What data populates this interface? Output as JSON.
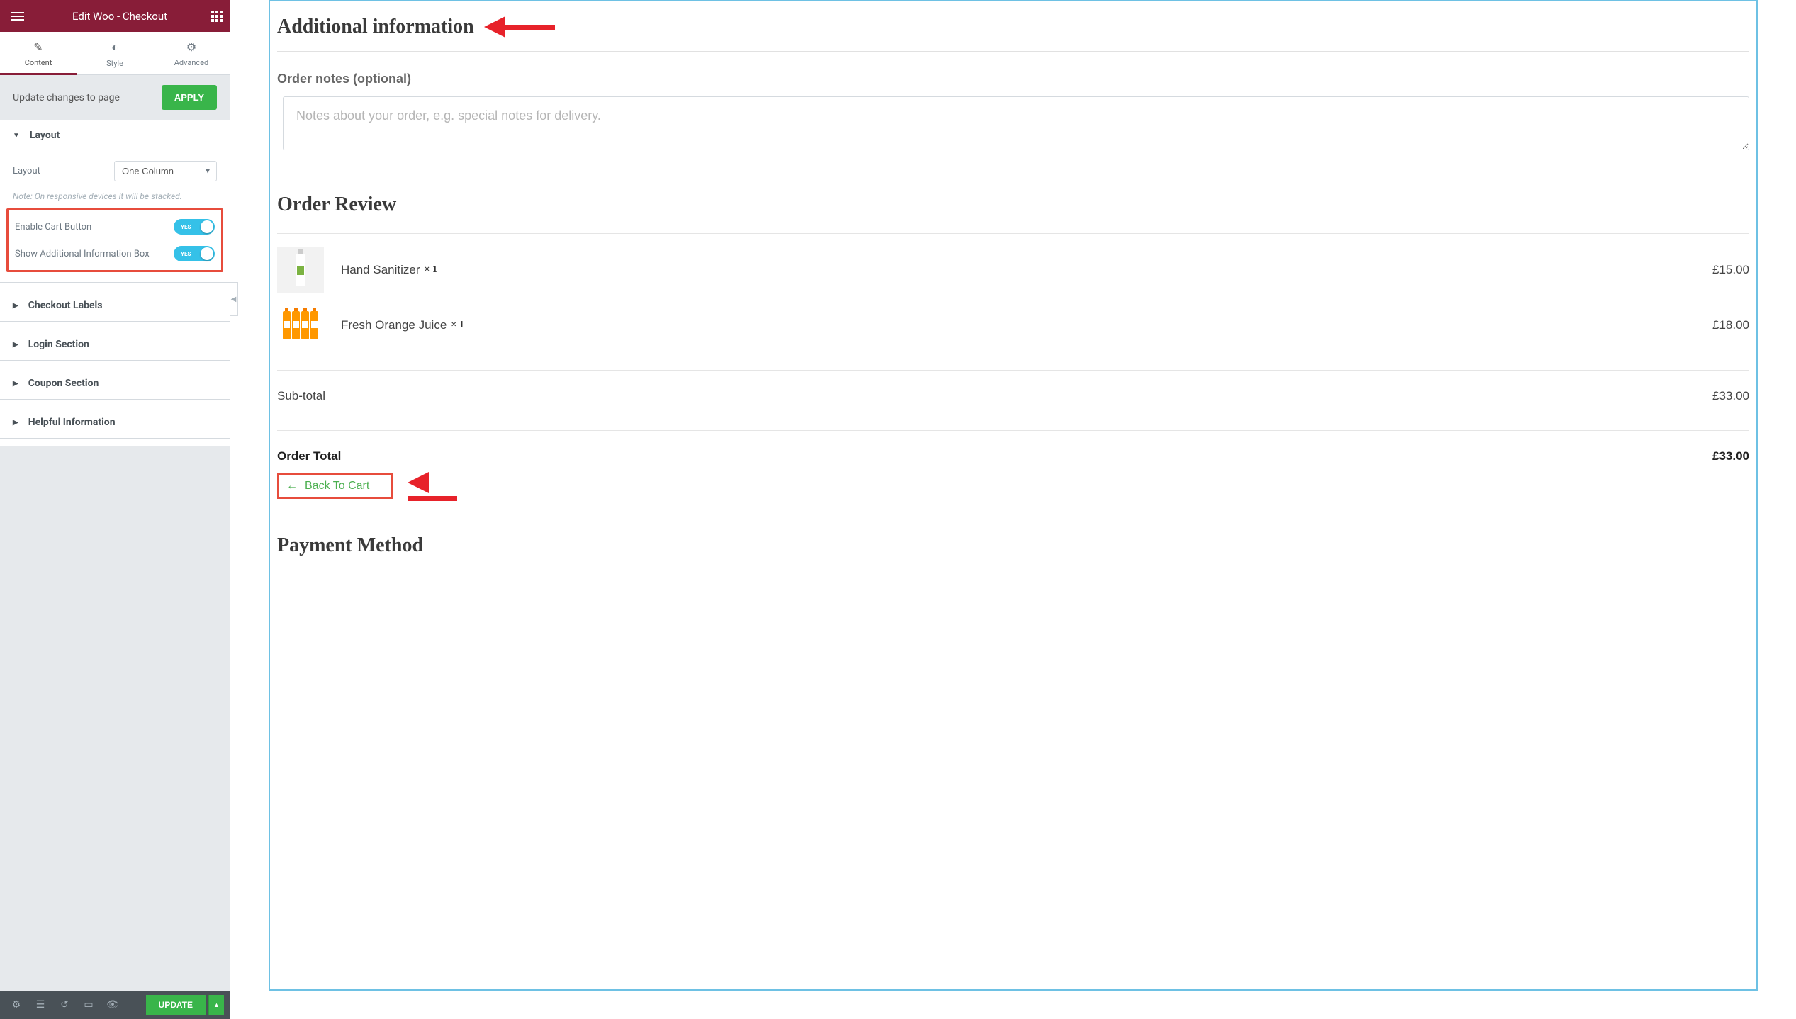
{
  "sidebar": {
    "title": "Edit Woo - Checkout",
    "tabs": {
      "content": "Content",
      "style": "Style",
      "advanced": "Advanced"
    },
    "update_text": "Update changes to page",
    "apply_btn": "APPLY",
    "sections": {
      "layout": {
        "title": "Layout",
        "layout_label": "Layout",
        "layout_value": "One Column",
        "note": "Note: On responsive devices it will be stacked.",
        "enable_cart_label": "Enable Cart Button",
        "enable_cart_value": "YES",
        "show_additional_label": "Show Additional Information Box",
        "show_additional_value": "YES"
      },
      "checkout_labels": "Checkout Labels",
      "login_section": "Login Section",
      "coupon_section": "Coupon Section",
      "helpful_information": "Helpful Information"
    },
    "footer_update": "UPDATE"
  },
  "canvas": {
    "additional_info_heading": "Additional information",
    "order_notes_label": "Order notes (optional)",
    "order_notes_placeholder": "Notes about your order, e.g. special notes for delivery.",
    "order_review_heading": "Order Review",
    "items": [
      {
        "name": "Hand Sanitizer",
        "qty": "× 1",
        "price": "£15.00"
      },
      {
        "name": "Fresh Orange Juice",
        "qty": "× 1",
        "price": "£18.00"
      }
    ],
    "subtotal_label": "Sub-total",
    "subtotal_value": "£33.00",
    "order_total_label": "Order Total",
    "order_total_value": "£33.00",
    "back_to_cart": "Back To Cart",
    "payment_method_heading": "Payment Method"
  }
}
